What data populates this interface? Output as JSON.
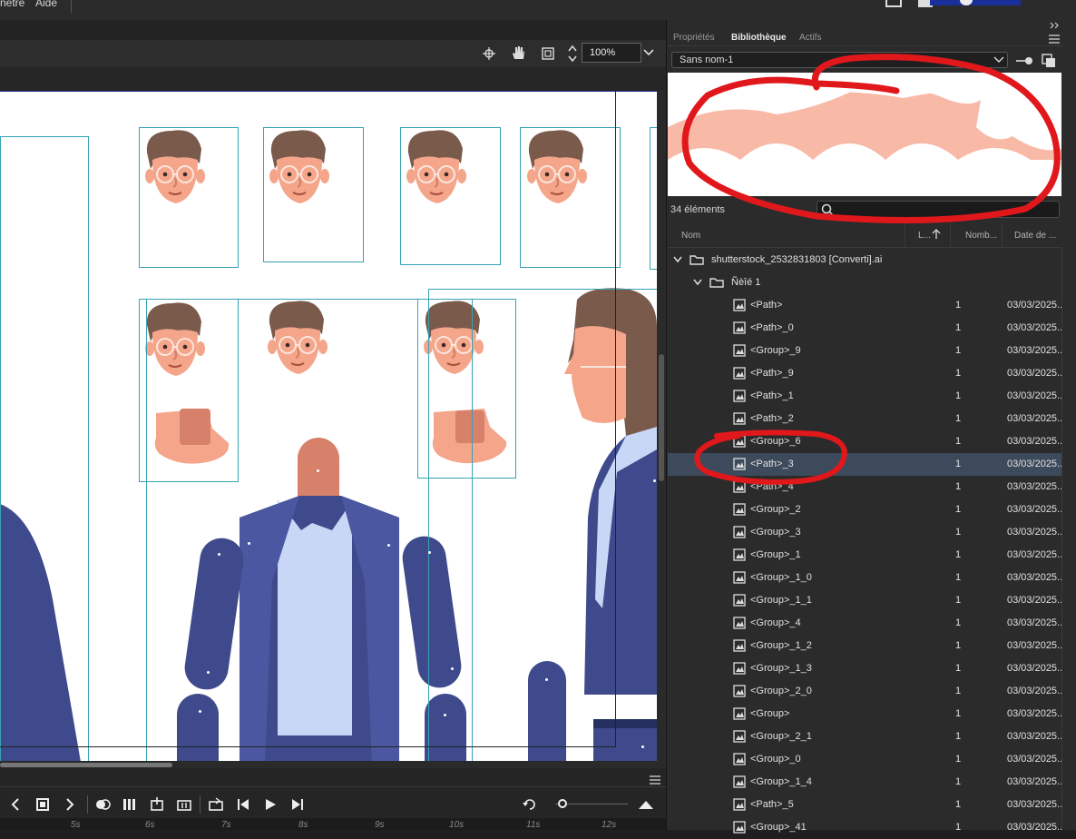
{
  "menu": {
    "items": [
      "nêtre",
      "Aide"
    ]
  },
  "toolbar": {
    "zoom": "100%"
  },
  "panel": {
    "tabs": [
      "Propriétés",
      "Bibliothèque",
      "Actifs"
    ],
    "active_tab": "Bibliothèque",
    "document_select": "Sans nom-1",
    "item_count": "34 éléments",
    "columns": {
      "name": "Nom",
      "linkage": "L...",
      "count": "Nomb...",
      "date": "Date de ..."
    },
    "folder": "shutterstock_2532831803 [Converti].ai",
    "subfolder": "Ñèîé 1",
    "rows": [
      {
        "name": "<Path>",
        "count": "1",
        "date": "03/03/2025..."
      },
      {
        "name": "<Path>_0",
        "count": "1",
        "date": "03/03/2025..."
      },
      {
        "name": "<Group>_9",
        "count": "1",
        "date": "03/03/2025..."
      },
      {
        "name": "<Path>_9",
        "count": "1",
        "date": "03/03/2025..."
      },
      {
        "name": "<Path>_1",
        "count": "1",
        "date": "03/03/2025..."
      },
      {
        "name": "<Path>_2",
        "count": "1",
        "date": "03/03/2025..."
      },
      {
        "name": "<Group>_6",
        "count": "1",
        "date": "03/03/2025..."
      },
      {
        "name": "<Path>_3",
        "count": "1",
        "date": "03/03/2025..."
      },
      {
        "name": "<Path>_4",
        "count": "1",
        "date": "03/03/2025..."
      },
      {
        "name": "<Group>_2",
        "count": "1",
        "date": "03/03/2025..."
      },
      {
        "name": "<Group>_3",
        "count": "1",
        "date": "03/03/2025..."
      },
      {
        "name": "<Group>_1",
        "count": "1",
        "date": "03/03/2025..."
      },
      {
        "name": "<Group>_1_0",
        "count": "1",
        "date": "03/03/2025..."
      },
      {
        "name": "<Group>_1_1",
        "count": "1",
        "date": "03/03/2025..."
      },
      {
        "name": "<Group>_4",
        "count": "1",
        "date": "03/03/2025..."
      },
      {
        "name": "<Group>_1_2",
        "count": "1",
        "date": "03/03/2025..."
      },
      {
        "name": "<Group>_1_3",
        "count": "1",
        "date": "03/03/2025..."
      },
      {
        "name": "<Group>_2_0",
        "count": "1",
        "date": "03/03/2025..."
      },
      {
        "name": "<Group>",
        "count": "1",
        "date": "03/03/2025..."
      },
      {
        "name": "<Group>_2_1",
        "count": "1",
        "date": "03/03/2025..."
      },
      {
        "name": "<Group>_0",
        "count": "1",
        "date": "03/03/2025..."
      },
      {
        "name": "<Group>_1_4",
        "count": "1",
        "date": "03/03/2025..."
      },
      {
        "name": "<Path>_5",
        "count": "1",
        "date": "03/03/2025..."
      },
      {
        "name": "<Group>_41",
        "count": "1",
        "date": "03/03/2025..."
      }
    ],
    "selected_row": "<Path>_3"
  },
  "timeline": {
    "ticks": [
      "5s",
      "6s",
      "7s",
      "8s",
      "9s",
      "10s",
      "11s",
      "12s"
    ]
  },
  "colors": {
    "annotation": "#e0181c",
    "suit": "#3f4a8c",
    "skin": "#f4a58a",
    "hair": "#7a5a4b",
    "selection": "#37a2b5",
    "shirt": "#c7d7f5"
  },
  "icons": [
    "chevron-left",
    "stop",
    "chevron-right",
    "play",
    "step-forward",
    "step-backward",
    "loop",
    "zoom-in",
    "pin",
    "copy"
  ]
}
